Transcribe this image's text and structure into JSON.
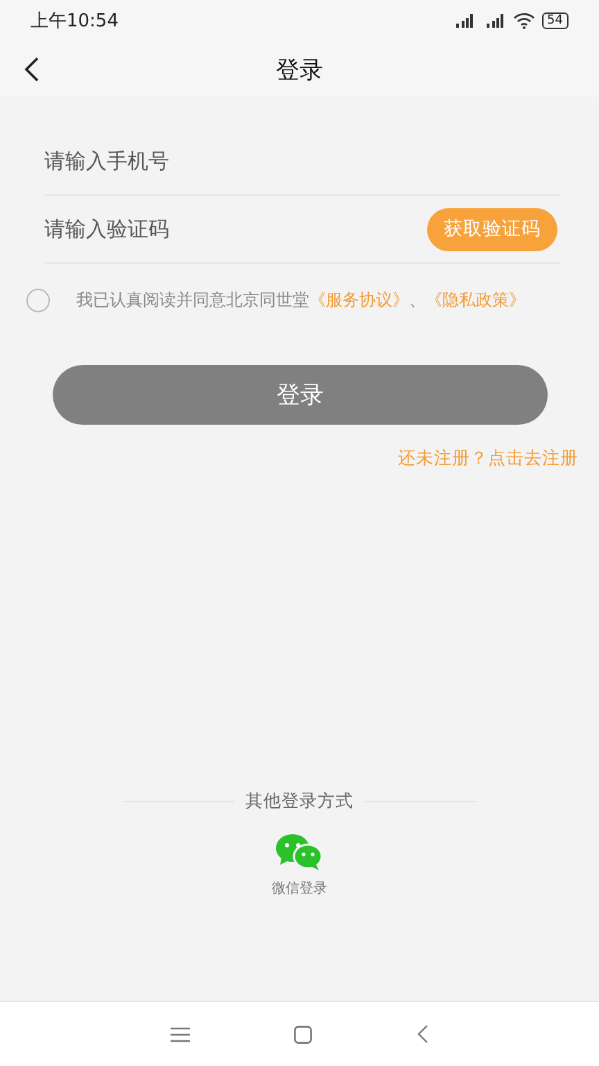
{
  "status_bar": {
    "time": "上午10:54",
    "battery": "54"
  },
  "header": {
    "title": "登录"
  },
  "form": {
    "phone_placeholder": "请输入手机号",
    "code_placeholder": "请输入验证码",
    "code_button": "获取验证码"
  },
  "agreement": {
    "checked": false,
    "text": "我已认真阅读并同意北京同世堂",
    "links": [
      "《服务协议》",
      "《隐私政策》"
    ],
    "separator": "、"
  },
  "login_button": "登录",
  "register_link": "还未注册？点击去注册",
  "other_login": {
    "title": "其他登录方式",
    "options": [
      {
        "kind": "wechat",
        "label": "微信登录"
      }
    ]
  }
}
